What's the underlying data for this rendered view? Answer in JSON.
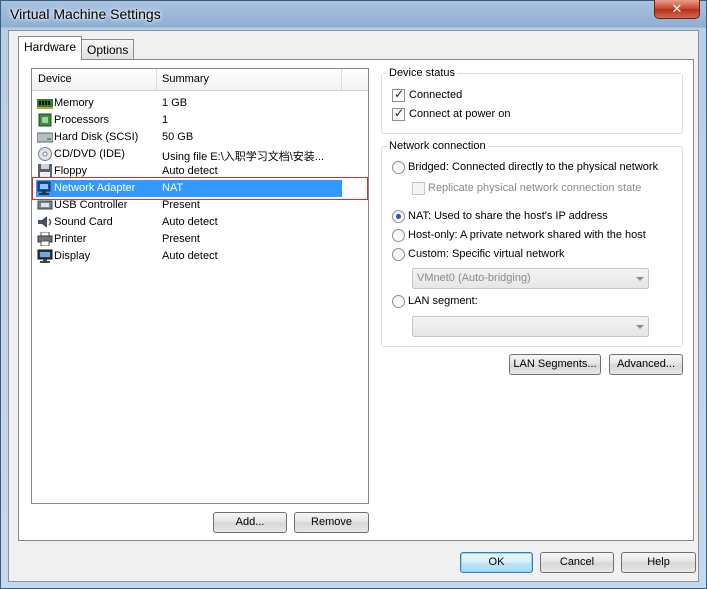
{
  "window": {
    "title": "Virtual Machine Settings",
    "close_glyph": "✕"
  },
  "tabs": [
    {
      "label": "Hardware"
    },
    {
      "label": "Options"
    }
  ],
  "device_list": {
    "col_device": "Device",
    "col_summary": "Summary",
    "devices": [
      {
        "name": "Memory",
        "summary": "1 GB",
        "icon": "memory-icon"
      },
      {
        "name": "Processors",
        "summary": "1",
        "icon": "processor-icon"
      },
      {
        "name": "Hard Disk (SCSI)",
        "summary": "50 GB",
        "icon": "hard-disk-icon"
      },
      {
        "name": "CD/DVD (IDE)",
        "summary": "Using file E:\\入职学习文档\\安装...",
        "icon": "cd-dvd-icon"
      },
      {
        "name": "Floppy",
        "summary": "Auto detect",
        "icon": "floppy-icon"
      },
      {
        "name": "Network Adapter",
        "summary": "NAT",
        "icon": "network-adapter-icon"
      },
      {
        "name": "USB Controller",
        "summary": "Present",
        "icon": "usb-icon"
      },
      {
        "name": "Sound Card",
        "summary": "Auto detect",
        "icon": "sound-card-icon"
      },
      {
        "name": "Printer",
        "summary": "Present",
        "icon": "printer-icon"
      },
      {
        "name": "Display",
        "summary": "Auto detect",
        "icon": "display-icon"
      }
    ],
    "add_label": "Add...",
    "remove_label": "Remove"
  },
  "device_status": {
    "title": "Device status",
    "connected_label": "Connected",
    "connected_checked": true,
    "power_on_label": "Connect at power on",
    "power_on_checked": true
  },
  "network_connection": {
    "title": "Network connection",
    "bridged_label": "Bridged: Connected directly to the physical network",
    "replicate_label": "Replicate physical network connection state",
    "nat_label": "NAT: Used to share the host's IP address",
    "hostonly_label": "Host-only: A private network shared with the host",
    "custom_label": "Custom: Specific virtual network",
    "vmnet_value": "VMnet0 (Auto-bridging)",
    "lan_segment_label": "LAN segment:",
    "lan_segment_value": "",
    "selected": "nat"
  },
  "actions": {
    "lan_segments_label": "LAN Segments...",
    "advanced_label": "Advanced...",
    "ok_label": "OK",
    "cancel_label": "Cancel",
    "help_label": "Help"
  },
  "colors": {
    "selection": "#3399ff",
    "highlight_border": "#d03030"
  }
}
